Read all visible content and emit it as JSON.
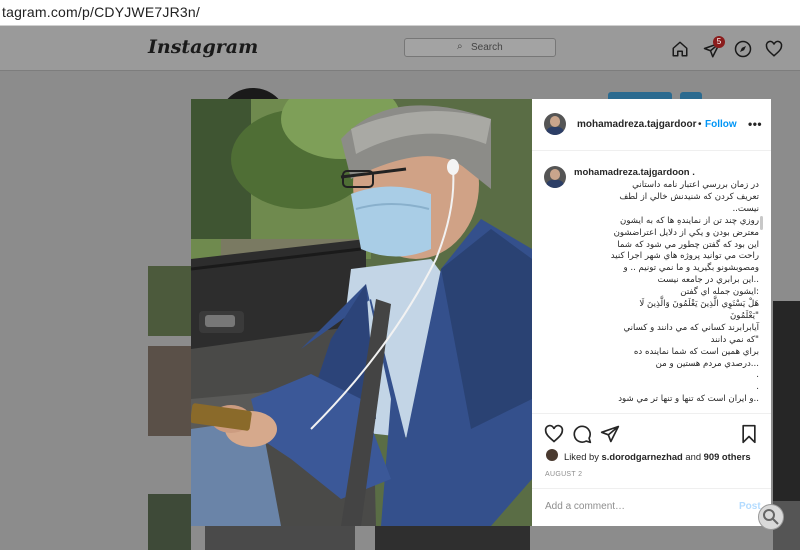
{
  "browser": {
    "url": "tagram.com/p/CDYJWE7JR3n/"
  },
  "header": {
    "logo": "Instagram",
    "search_placeholder": "Search",
    "dm_badge": "5"
  },
  "post": {
    "username": "mohamadreza.tajgardoor",
    "separator": "•",
    "follow_label": "Follow",
    "more_label": "•••",
    "caption_username": "mohamadreza.tajgardoon .",
    "caption_lines": [
      "در زمان بررسي اعتبار نامه داستاني",
      "تعريف كردن كه شنيدنش خالي از لطف",
      "نيست..",
      "روزي چند تن از نمايندهِ ها كه به ايشون",
      "معترض بودن و يكي از دلايل اعتراضشون",
      "اين بود كه گفتن چطور مي شود كه شما",
      "راحت مي توانيد پروژه هاي شهر اجرا كنيد",
      "ومصوبشونو بگيريد و ما نمي تونيم .. و",
      "..اين برابري در جامعه نيست",
      ":ايشون جمله اي گفتن",
      "هَلْ يَسْتَوِي الَّذِينَ يَعْلَمُونَ وَالَّذِينَ لَا",
      "\"يَعْلَمُونَ",
      "آيابرابرند كساني كه مي دانند و كساني",
      "\"كه نمي دانند",
      "براي همين است كه شما نماينده ده",
      "...درصدي مردم هستين و من",
      ".",
      ".",
      "..و ايران است كه تنها و تنها تر مي شود"
    ],
    "liked_prefix": "Liked by ",
    "liked_user": "s.dorodgarnezhad",
    "liked_and": " and ",
    "liked_count": "909 others",
    "date": "AUGUST 2",
    "comment_placeholder": "Add a comment…",
    "post_label": "Post"
  },
  "colors": {
    "accent": "#0095f6",
    "post_disabled": "#b3dbff",
    "overlay": "#8c8c8c"
  }
}
